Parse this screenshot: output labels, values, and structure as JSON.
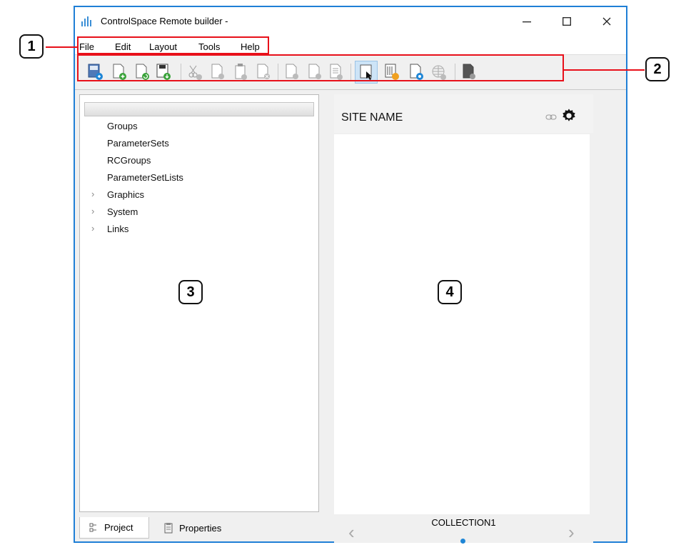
{
  "window": {
    "title": "ControlSpace Remote builder -",
    "title_icon": "app-bars-icon",
    "controls": {
      "minimize": "minimize-icon",
      "maximize": "maximize-icon",
      "close": "close-icon"
    }
  },
  "menu": {
    "items": [
      "File",
      "Edit",
      "Layout",
      "Tools",
      "Help"
    ]
  },
  "toolbar": {
    "buttons": [
      "open-project-icon",
      "new-page-icon",
      "refresh-page-icon",
      "save-project-icon",
      "cut-icon",
      "copy-icon",
      "paste-icon",
      "delete-icon",
      "import-icon",
      "export-icon",
      "document-icon",
      "touch-select-icon",
      "keypad-icon",
      "page-link-icon",
      "globe-icon",
      "dark-page-icon"
    ]
  },
  "tree": {
    "items": [
      {
        "label": "Groups",
        "expandable": false
      },
      {
        "label": "ParameterSets",
        "expandable": false
      },
      {
        "label": "RCGroups",
        "expandable": false
      },
      {
        "label": "ParameterSetLists",
        "expandable": false
      },
      {
        "label": "Graphics",
        "expandable": true
      },
      {
        "label": "System",
        "expandable": true
      },
      {
        "label": "Links",
        "expandable": true
      }
    ]
  },
  "tabs": {
    "project": "Project",
    "properties": "Properties"
  },
  "preview": {
    "site_name": "SITE NAME",
    "collection": "COLLECTION1",
    "link_icon": "link-icon",
    "settings_icon": "gear-icon",
    "prev_icon": "chevron-left-icon",
    "next_icon": "chevron-right-icon"
  },
  "callouts": [
    "1",
    "2",
    "3",
    "4"
  ],
  "colors": {
    "window_border": "#1f7fd6",
    "callout": "#e8101a",
    "accent_dot": "#1f86d6"
  }
}
